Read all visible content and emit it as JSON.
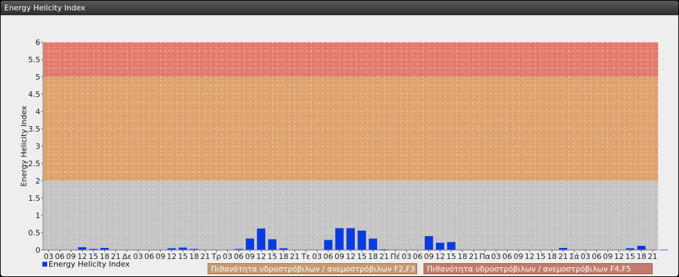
{
  "window": {
    "title": "Energy Helicity Index"
  },
  "legend": {
    "series_label": "Energy Helicity Index",
    "band_f2f3": "Πιθανότητα υδροστρόβιλων / ανεμοστρόβιλων F2,F3",
    "band_f4f5": "Πιθανότητα υδροστρόβιλων / ανεμοστρόβιλων F4,F5"
  },
  "colors": {
    "bar": "#0a3be0",
    "band_low": "#c4c4c4",
    "band_mid": "#dda26d",
    "band_high": "#e27b6c",
    "legend_f2f3": "#c39a72",
    "legend_f4f5": "#c27b6c"
  },
  "chart_data": {
    "type": "bar",
    "title": "",
    "xlabel": "",
    "ylabel": "Energy Helicity Index",
    "ylim": [
      0,
      6
    ],
    "yticks": [
      "0",
      "0.5",
      "1",
      "1.5",
      "2",
      "2.5",
      "3",
      "3.5",
      "4",
      "4.5",
      "5",
      "5.5",
      "6"
    ],
    "grid": true,
    "bands": [
      {
        "from": 0,
        "to": 2,
        "color": "#c4c4c4"
      },
      {
        "from": 2,
        "to": 5,
        "color": "#dda26d"
      },
      {
        "from": 5,
        "to": 6,
        "color": "#e27b6c"
      }
    ],
    "categories": [
      "03",
      "06",
      "09",
      "12",
      "15",
      "18",
      "21",
      "Δε",
      "03",
      "06",
      "09",
      "12",
      "15",
      "18",
      "21",
      "Τρ",
      "03",
      "06",
      "09",
      "12",
      "15",
      "18",
      "21",
      "Τε",
      "03",
      "06",
      "09",
      "12",
      "15",
      "18",
      "21",
      "Πέ",
      "03",
      "06",
      "09",
      "12",
      "15",
      "18",
      "21",
      "Πα",
      "03",
      "06",
      "09",
      "12",
      "15",
      "18",
      "21",
      "Σά",
      "03",
      "06",
      "09",
      "12",
      "15",
      "18",
      "21"
    ],
    "series": [
      {
        "name": "Energy Helicity Index",
        "values": [
          0.01,
          0.01,
          0.01,
          0.08,
          0.03,
          0.06,
          0.01,
          0.01,
          0.01,
          0.01,
          0.01,
          0.05,
          0.07,
          0.03,
          0.01,
          0.01,
          0.01,
          0.03,
          0.33,
          0.62,
          0.31,
          0.05,
          0.01,
          0.01,
          0.01,
          0.29,
          0.63,
          0.63,
          0.56,
          0.33,
          0.02,
          0.01,
          0.01,
          0.01,
          0.4,
          0.21,
          0.23,
          0.01,
          0.01,
          0.01,
          0.01,
          0.01,
          0.01,
          0.01,
          0.01,
          0.01,
          0.06,
          0.01,
          0.01,
          0.01,
          0.01,
          0.01,
          0.05,
          0.12,
          0.01,
          0.01
        ]
      }
    ]
  }
}
